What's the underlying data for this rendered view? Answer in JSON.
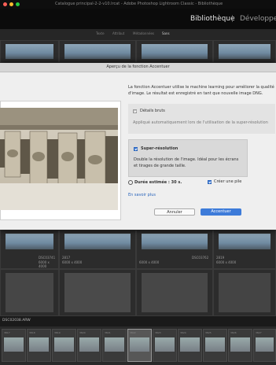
{
  "window": {
    "title": "Catalogue principal-2-2-v10.lrcat - Adobe Photoshop Lightroom Classic - Bibliothèque",
    "traffic_colors": [
      "#ff5f57",
      "#febc2e",
      "#28c840"
    ]
  },
  "modules": {
    "active": "Bibliothèque",
    "separator": "|",
    "next": "Développer"
  },
  "filter_bar": {
    "items": [
      "Texte",
      "Attribut",
      "Métadonnées",
      "Sans"
    ]
  },
  "dialog": {
    "title": "Aperçu de la fonction Accentuer",
    "intro": [
      "La fonction Accentuer utilise le machine learning pour améliorer la qualité",
      "d'image. Le résultat est enregistré en tant que nouvelle image DNG."
    ],
    "raw_details": {
      "label": "Détails bruts",
      "description": "Appliqué automatiquement lors de l'utilisation de la super-résolution",
      "checked": true
    },
    "super_resolution": {
      "label": "Super-résolution",
      "description": [
        "Double la résolution de l'image. Idéal pour les écrans",
        "et tirages de grande taille."
      ],
      "checked": true
    },
    "estimate": "Durée estimée : 30 s.",
    "create_stack": {
      "label": "Créer une pile",
      "checked": true
    },
    "learn_more": "En savoir plus",
    "cancel_label": "Annuler",
    "confirm_label": "Accentuer"
  },
  "grid_rows": [
    {
      "names": [
        "DSC03741",
        "2817",
        "DSC03762",
        "2819"
      ],
      "sizes": [
        "6000 x 4000",
        "6000 x 4000",
        "6000 x 4000",
        "6000 x 4000"
      ]
    }
  ],
  "filmstrip": {
    "label": "DSC02038.ARW",
    "thumb_labels": [
      "3817",
      "3818",
      "3819",
      "3820",
      "3821",
      "3822",
      "3823",
      "3824",
      "3825",
      "3826",
      "3827"
    ]
  },
  "colors": {
    "accent": "#3d7bd9",
    "link": "#2a64bb",
    "dialog_bg": "#efefef"
  }
}
